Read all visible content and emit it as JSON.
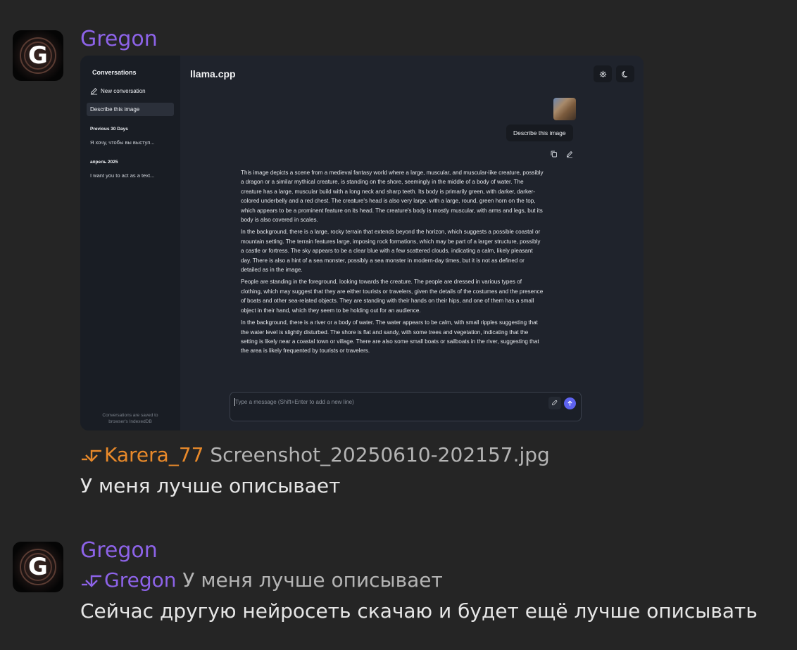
{
  "messages": [
    {
      "author": "Gregon",
      "reply_to": {
        "author": "Karera_77",
        "text": "Screenshot_20250610-202157.jpg"
      },
      "text": "У меня лучше описывает",
      "attachment": {
        "sidebar": {
          "title": "Conversations",
          "new_conversation": "New conversation",
          "selected": "Describe this image",
          "sections": [
            {
              "label": "Previous 30 Days",
              "items": [
                "Я хочу, чтобы вы выступ..."
              ]
            },
            {
              "label": "апрель 2025",
              "items": [
                "I want you to act as a text..."
              ]
            }
          ],
          "footer": [
            "Conversations are saved to",
            "browser's IndexedDB"
          ]
        },
        "title": "llama.cpp",
        "user_message": "Describe this image",
        "response_paragraphs": [
          "This image depicts a scene from a medieval fantasy world where a large, muscular, and muscular-like creature, possibly a dragon or a similar mythical creature, is standing on the shore, seemingly in the middle of a body of water. The creature has a large, muscular build with a long neck and sharp teeth. Its body is primarily green, with darker, darker-colored underbelly and a red chest. The creature's head is also very large, with a large, round, green horn on the top, which appears to be a prominent feature on its head. The creature's body is mostly muscular, with arms and legs, but its body is also covered in scales.",
          "In the background, there is a large, rocky terrain that extends beyond the horizon, which suggests a possible coastal or mountain setting. The terrain features large, imposing rock formations, which may be part of a larger structure, possibly a castle or fortress. The sky appears to be a clear blue with a few scattered clouds, indicating a calm, likely pleasant day. There is also a hint of a sea monster, possibly a sea monster in modern-day times, but it is not as defined or detailed as in the image.",
          "People are standing in the foreground, looking towards the creature. The people are dressed in various types of clothing, which may suggest that they are either tourists or travelers, given the details of the costumes and the presence of boats and other sea-related objects. They are standing with their hands on their hips, and one of them has a small object in their hand, which they seem to be holding out for an audience.",
          "In the background, there is a river or a body of water. The water appears to be calm, with small ripples suggesting that the water level is slightly disturbed. The shore is flat and sandy, with some trees and vegetation, indicating that the setting is likely near a coastal town or village. There are also some small boats or sailboats in the river, suggesting that the area is likely frequented by tourists or travelers."
        ],
        "input_placeholder": "Type a message (Shift+Enter to add a new line)"
      }
    },
    {
      "author": "Gregon",
      "reply_to": {
        "author": "Gregon",
        "text": "У меня лучше описывает"
      },
      "text": "Сейчас другую нейросеть скачаю и будет ещё лучше описывать"
    }
  ],
  "colors": {
    "background": "#252525",
    "author_purple": "#8d63e8",
    "reply_orange": "#e8892a",
    "send_button": "#5e63f0"
  },
  "icons": [
    "reply-arrow-icon",
    "avatar-g-logo",
    "edit-icon",
    "gear-icon",
    "moon-icon",
    "copy-icon",
    "paperclip-icon",
    "arrow-up-icon"
  ]
}
